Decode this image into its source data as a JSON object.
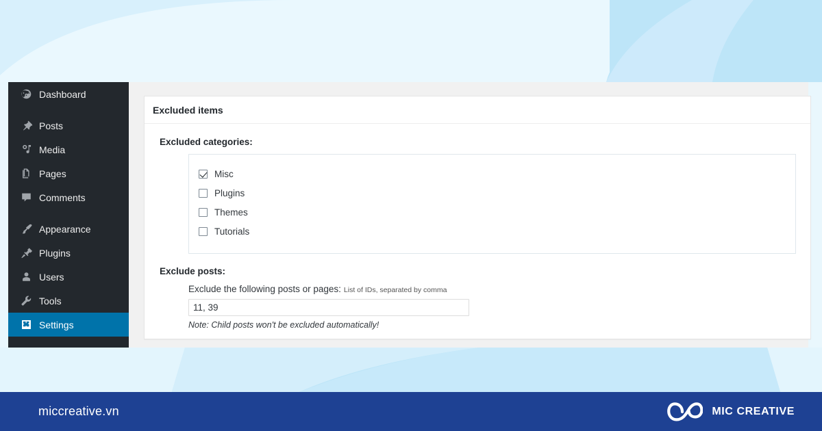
{
  "background": {
    "base_color": "#e9f7fd",
    "shape_colors": [
      "#d8f0fc",
      "#bde5f8",
      "#cdeafb",
      "#eaf8fe"
    ]
  },
  "sidebar": {
    "background_color": "#23282d",
    "active_color": "#0073aa",
    "items": [
      {
        "label": "Dashboard",
        "icon": "dashboard-icon",
        "current": false,
        "gap_after": true
      },
      {
        "label": "Posts",
        "icon": "pin-icon",
        "current": false,
        "gap_after": false
      },
      {
        "label": "Media",
        "icon": "media-icon",
        "current": false,
        "gap_after": false
      },
      {
        "label": "Pages",
        "icon": "pages-icon",
        "current": false,
        "gap_after": false
      },
      {
        "label": "Comments",
        "icon": "comment-icon",
        "current": false,
        "gap_after": true
      },
      {
        "label": "Appearance",
        "icon": "paintbrush-icon",
        "current": false,
        "gap_after": false
      },
      {
        "label": "Plugins",
        "icon": "plug-icon",
        "current": false,
        "gap_after": false
      },
      {
        "label": "Users",
        "icon": "user-icon",
        "current": false,
        "gap_after": false
      },
      {
        "label": "Tools",
        "icon": "wrench-icon",
        "current": false,
        "gap_after": false
      },
      {
        "label": "Settings",
        "icon": "sliders-icon",
        "current": true,
        "gap_after": false
      }
    ]
  },
  "panel": {
    "title": "Excluded items",
    "categories_label": "Excluded categories:",
    "categories": [
      {
        "label": "Misc",
        "checked": true
      },
      {
        "label": "Plugins",
        "checked": false
      },
      {
        "label": "Themes",
        "checked": false
      },
      {
        "label": "Tutorials",
        "checked": false
      }
    ],
    "exclude_posts_label": "Exclude posts:",
    "exclude_posts_inline_label": "Exclude the following posts or pages:",
    "exclude_posts_hint": "List of IDs, separated by comma",
    "ids_value": "11, 39",
    "ids_placeholder": "",
    "note": "Note: Child posts won't be excluded automatically!"
  },
  "footer": {
    "url": "miccreative.vn",
    "brand_name": "MIC CREATIVE",
    "brand_icon": "infinity-loop-logo",
    "background_color": "#1e4193"
  }
}
